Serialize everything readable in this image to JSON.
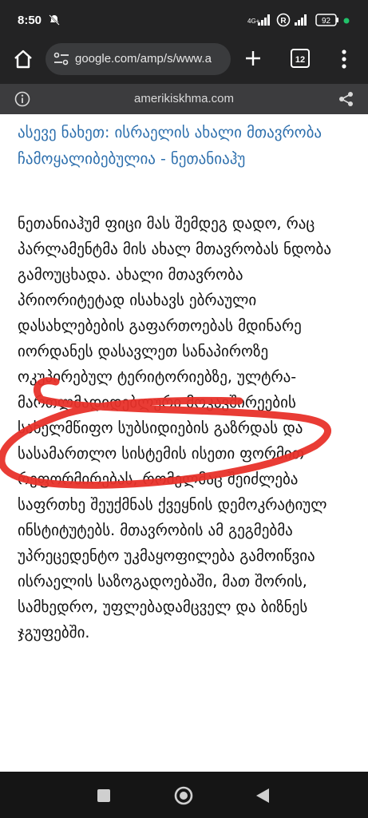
{
  "status_bar": {
    "time": "8:50",
    "network": "4G+",
    "battery": "92",
    "icons": [
      "notification-mute-icon",
      "signal-icon",
      "roaming-icon",
      "signal-icon-2",
      "battery-icon",
      "dot-icon"
    ]
  },
  "browser": {
    "url": "google.com/amp/s/www.a",
    "tab_count": "12",
    "icons": [
      "home-icon",
      "site-settings-icon",
      "new-tab-icon",
      "tab-switcher-icon",
      "menu-icon"
    ]
  },
  "amp_bar": {
    "domain": "amerikiskhma.com",
    "icons": [
      "info-icon",
      "share-icon"
    ]
  },
  "article": {
    "related_link": "ასევე ნახეთ: ისრაელის ახალი მთავრობა ჩამოყალიბებულია - ნეთანიაჰუ",
    "paragraph": "ნეთანიაჰუმ ფიცი მას შემდეგ დადო, რაც პარლამენტმა მის ახალ მთავრობას ნდობა გამოუცხადა. ახალი მთავრობა პრიორიტეტად ისახავს ებრაული დასახლებების გაფართოებას მდინარე იორდანეს დასავლეთ სანაპიროზე ოკუპირებულ ტერიტორიებზე, ულტრა-მართლმადიდებლური მოკავშირეების სახელმწიფო სუბსიდიების გაზრდას და სასამართლო სისტემის ისეთი ფორმით რეფორმირებას, რომელმაც შეიძლება საფრთხე შეუქმნას ქვეყნის დემოკრატიულ ინსტიტუტებს. მთავრობის ამ გეგმებმა უპრეცედენტო უკმაყოფილება გამოიწვია ისრაელის საზოგადოებაში, მათ შორის, სამხედრო, უფლებადამცველ და ბიზნეს ჯგუფებში."
  },
  "annotation": {
    "color": "#e8322a"
  },
  "nav_bar": {
    "icons": [
      "recents-icon",
      "home-circle-icon",
      "back-icon"
    ]
  },
  "colors": {
    "bar": "#232324",
    "link": "#2d6fad",
    "accent_dot": "#21c26a"
  }
}
